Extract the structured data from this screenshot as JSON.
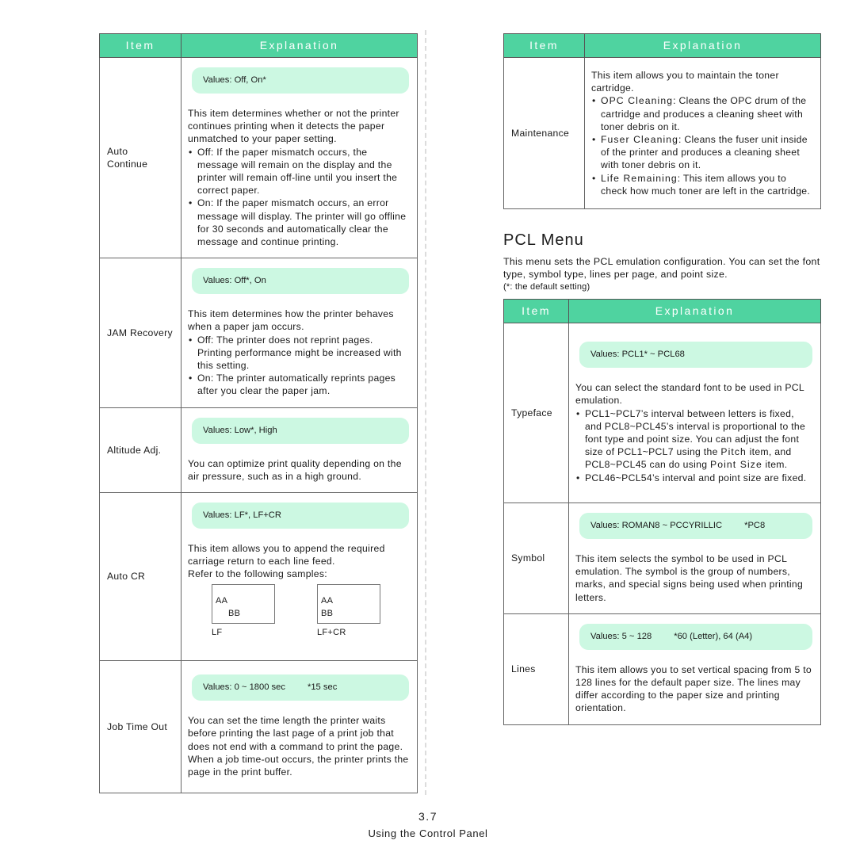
{
  "header": {
    "item": "Item",
    "explanation": "Explanation"
  },
  "left_table": {
    "auto_continue": {
      "item_line1": "Auto",
      "item_line2": "Continue",
      "values": "Values: Off, On*",
      "intro": "This item determines whether or not the printer continues printing when it detects the paper unmatched to your paper setting.",
      "bullets": [
        "Off: If the paper mismatch occurs, the message will remain on the display and the printer will remain off-line until you insert the correct paper.",
        "On: If the paper mismatch occurs, an error message will display. The printer will go offline for 30 seconds and automatically clear the message and continue printing."
      ]
    },
    "jam_recovery": {
      "item": "JAM Recovery",
      "values": "Values: Off*, On",
      "intro": "This item determines how the printer behaves when a paper jam occurs.",
      "bullets": [
        "Off: The printer does not reprint pages. Printing performance might be increased with this setting.",
        "On: The printer automatically reprints pages after you clear the paper jam."
      ]
    },
    "altitude_adj": {
      "item": "Altitude Adj.",
      "values": "Values: Low*, High",
      "text": "You can optimize print quality depending on the air pressure, such as in a high ground."
    },
    "auto_cr": {
      "item": "Auto CR",
      "values": "Values: LF*, LF+CR",
      "text1": "This item allows you to append the required carriage return to each line feed.",
      "text2": "Refer to the following samples:",
      "samples": [
        {
          "line1": "AA",
          "line2": "BB",
          "caption": "LF"
        },
        {
          "line1": "AA",
          "line2": "BB",
          "caption": "LF+CR"
        }
      ]
    },
    "job_time_out": {
      "item": "Job Time Out",
      "values_range": "Values: 0 ~ 1800 sec",
      "values_default": "*15 sec",
      "text1": "You can set the time length the printer waits before printing the last page of a print job that does not end with a command to print the page.",
      "text2": "When a job time-out occurs, the printer prints the page in the print buffer."
    }
  },
  "right_table": {
    "maintenance": {
      "item": "Maintenance",
      "intro": "This item allows you to maintain the toner cartridge.",
      "bullets": [
        {
          "term": "OPC Cleaning",
          "text": ": Cleans the OPC drum of the cartridge and produces a cleaning sheet with toner debris on it."
        },
        {
          "term": "Fuser Cleaning",
          "text": ": Cleans the fuser unit inside of the printer and produces a cleaning sheet with toner debris on it."
        },
        {
          "term": "Life Remaining",
          "text": ": This item allows you to check how much toner are left in the cartridge."
        }
      ]
    }
  },
  "pcl_section": {
    "title": "PCL Menu",
    "intro": "This menu sets the PCL emulation configuration. You can set the font type, symbol type, lines per page, and point size.",
    "note": "(*: the default setting)"
  },
  "pcl_table": {
    "typeface": {
      "item": "Typeface",
      "values": "Values: PCL1* ~ PCL68",
      "intro": "You can select the standard font to be used in PCL emulation.",
      "bullet1_a": "PCL1~PCL7’s interval between letters is fixed, and PCL8~PCL45’s interval is proportional to the font type and point size. You can adjust the font size of PCL1~PCL7 using the ",
      "bullet1_term1": "Pitch",
      "bullet1_b": " item, and PCL8~PCL45 can do using ",
      "bullet1_term2": "Point Size",
      "bullet1_c": " item.",
      "bullet2": "PCL46~PCL54’s interval and point size are fixed."
    },
    "symbol": {
      "item": "Symbol",
      "values_range": "Values: ROMAN8 ~ PCCYRILLIC",
      "values_default": "*PC8",
      "text": "This item selects the symbol to be used in PCL emulation. The symbol is the group of numbers, marks, and special signs being used when printing letters."
    },
    "lines": {
      "item": "Lines",
      "values_range": "Values: 5 ~ 128",
      "values_default": "*60 (Letter), 64 (A4)",
      "text": "This item allows you to set vertical spacing from 5 to 128 lines for the default paper size. The lines may differ according to the paper size and printing orientation."
    }
  },
  "footer": {
    "page_number": "3.7",
    "chapter_title": "Using the Control Panel"
  },
  "colors": {
    "header_green": "#4fd3a0",
    "values_bg": "#ccf8e2",
    "divider": "#dcdcdc"
  }
}
